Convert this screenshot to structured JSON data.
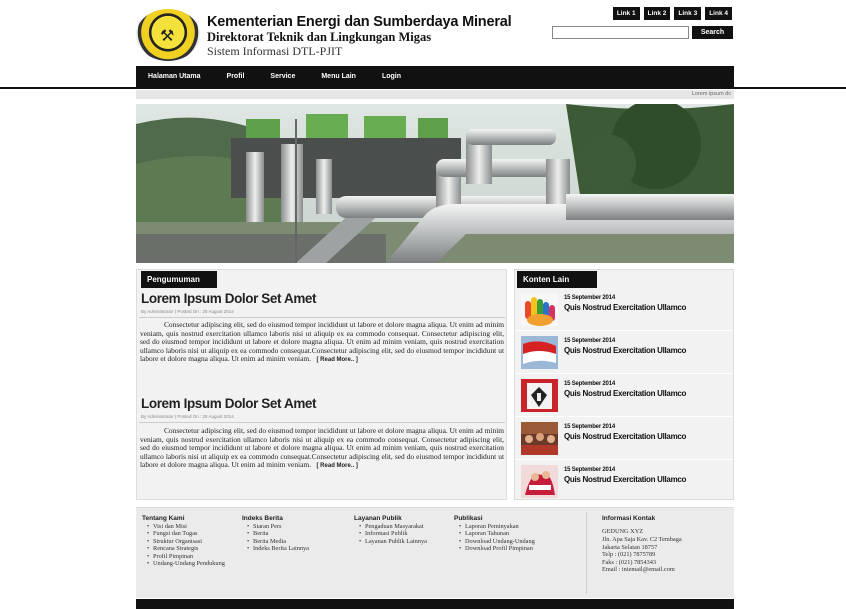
{
  "header": {
    "title": "Kementerian Energi dan Sumberdaya Mineral",
    "subtitle": "Direktorat Teknik dan Lingkungan Migas",
    "system": "Sistem Informasi DTL-PJIT",
    "top_links": [
      "Link 1",
      "Link 2",
      "Link 3",
      "Link 4"
    ],
    "search_placeholder": "",
    "search_button": "Search"
  },
  "nav": [
    "Halaman Utama",
    "Profil",
    "Service",
    "Menu Lain",
    "Login"
  ],
  "breadcrumb": "Lorem ipsum dc",
  "announcement": {
    "tab": "Pengumuman",
    "posts": [
      {
        "title": "Lorem Ipsum Dolor Set Amet",
        "meta": "By Administrator | Posted On : 28 August 2014",
        "body": "Consectetur adipiscing elit, sed do eiusmod tempor incididunt ut labore et dolore magna aliqua. Ut enim ad minim veniam, quis nostrud exercitation ullamco laboris nisi ut aliquip ex ea commodo consequat. Consectetur adipiscing elit, sed do eiusmod tempor incididunt ut labore et dolore magna aliqua. Ut enim ad minim veniam, quis nostrud exercitation ullamco laboris nisi ut aliquip ex ea commodo consequat.Consectetur adipiscing elit, sed do eiusmod tempor incididunt ut labore et dolore magna aliqua. Ut enim ad minim veniam.",
        "read_more": "[ Read More.. ]"
      },
      {
        "title": "Lorem Ipsum Dolor Set Amet",
        "meta": "By Administrator | Posted On : 28 August 2014",
        "body": "Consectetur adipiscing elit, sed do eiusmod tempor incididunt ut labore et dolore magna aliqua. Ut enim ad minim veniam, quis nostrud exercitation ullamco laboris nisi ut aliquip ex ea commodo consequat. Consectetur adipiscing elit, sed do eiusmod tempor incididunt ut labore et dolore magna aliqua. Ut enim ad minim veniam, quis nostrud exercitation ullamco laboris nisi ut aliquip ex ea commodo consequat.Consectetur adipiscing elit, sed do eiusmod tempor incididunt ut labore et dolore magna aliqua. Ut enim ad minim veniam.",
        "read_more": "[ Read More.. ]"
      }
    ]
  },
  "other_content": {
    "tab": "Konten Lain",
    "items": [
      {
        "date": "15 September 2014",
        "title": "Quis Nostrud Exercitation Ullamco"
      },
      {
        "date": "15 September 2014",
        "title": "Quis Nostrud Exercitation Ullamco"
      },
      {
        "date": "15 September 2014",
        "title": "Quis Nostrud Exercitation Ullamco"
      },
      {
        "date": "15 September 2014",
        "title": "Quis Nostrud Exercitation Ullamco"
      },
      {
        "date": "15 September 2014",
        "title": "Quis Nostrud Exercitation Ullamco"
      }
    ]
  },
  "footer": {
    "tentang": {
      "title": "Tentang Kami",
      "items": [
        "Visi dan Misi",
        "Fungsi dan Tugas",
        "Struktur Organisasi",
        "Rencana Strategis",
        "Profil Pimpinan",
        "Undang-Undang Pendukung"
      ]
    },
    "berita": {
      "title": "Indeks Berita",
      "items": [
        "Siaran Pers",
        "Berita",
        "Berita Media",
        "Indeks Berita Lainnya"
      ]
    },
    "layanan": {
      "title": "Layanan Publik",
      "items": [
        "Pengaduan Masyarakat",
        "Informasi Publik",
        "Layanan Publik Lainnya"
      ]
    },
    "publikasi": {
      "title": "Publikasi",
      "items": [
        "Laporan Peminyakan",
        "Laporan Tahunan",
        "Download Undang-Undang",
        "Download Profil Pimpinan"
      ]
    },
    "kontak": {
      "title": "Informasi Kontak",
      "lines": [
        "GEDUNG XYZ",
        "Jln. Apa Saja Kav. C2 Tembaga",
        "Jakarta Selatan 18757",
        "Telp : (021) 7875789",
        "Faks : (021) 7854343",
        "Email : iniemail@email.com"
      ]
    }
  }
}
